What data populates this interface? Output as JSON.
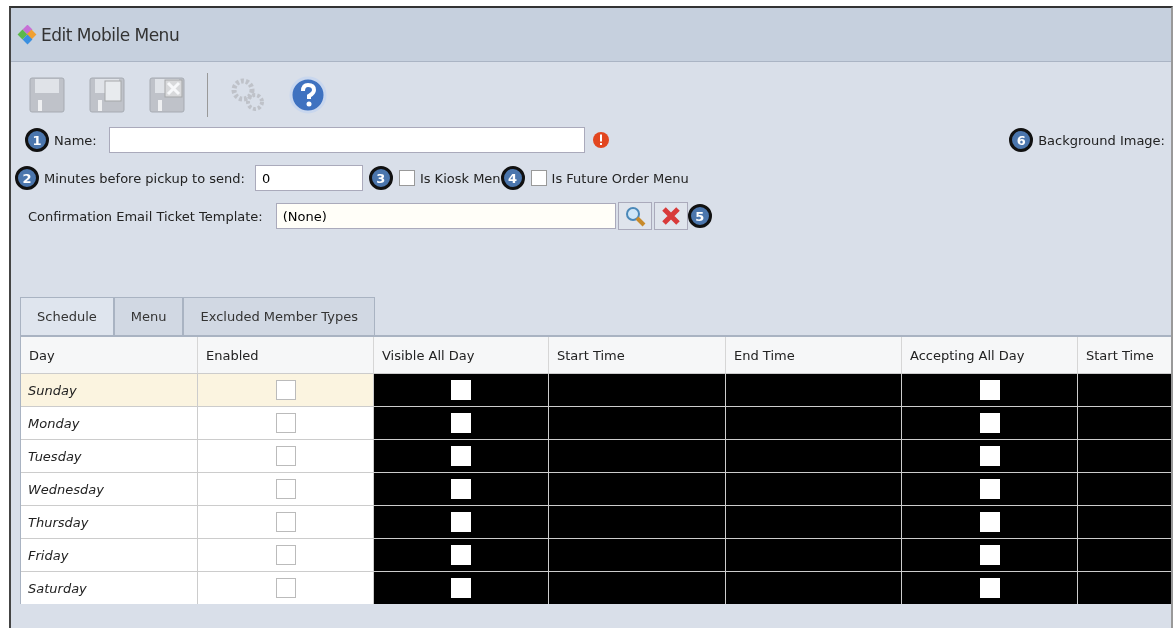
{
  "window": {
    "title": "Edit Mobile Menu"
  },
  "toolbar": [
    {
      "kind": "save",
      "disabled": true
    },
    {
      "kind": "save-new",
      "disabled": true
    },
    {
      "kind": "save-delete",
      "disabled": true
    },
    {
      "kind": "separator"
    },
    {
      "kind": "settings",
      "disabled": true
    },
    {
      "kind": "help",
      "disabled": false
    }
  ],
  "form": {
    "name": {
      "callout": "1",
      "label": "Name:",
      "error": true
    },
    "minutes": {
      "callout": "2",
      "label": "Minutes before pickup to send:",
      "value": "0"
    },
    "kiosk": {
      "callout": "3",
      "label": "Is Kiosk Men",
      "checked": false
    },
    "future": {
      "callout": "4",
      "label": "Is Future Order Menu",
      "checked": false
    },
    "template": {
      "label": "Confirmation Email Ticket Template:",
      "value": "(None)",
      "callout": "5"
    },
    "background": {
      "callout": "6",
      "label": "Background Image:"
    }
  },
  "tabs": [
    {
      "label": "Schedule",
      "selected": true
    },
    {
      "label": "Menu",
      "selected": false
    },
    {
      "label": "Excluded Member Types",
      "selected": false
    }
  ],
  "table": {
    "columns": [
      "Day",
      "Enabled",
      "Visible All Day",
      "Start Time",
      "End Time",
      "Accepting All Day",
      "Start Time"
    ],
    "rows": [
      {
        "day": "Sunday",
        "selected": true,
        "enabled": false,
        "visible_all_day": false,
        "accepting_all_day": false
      },
      {
        "day": "Monday",
        "selected": false,
        "enabled": false,
        "visible_all_day": false,
        "accepting_all_day": false
      },
      {
        "day": "Tuesday",
        "selected": false,
        "enabled": false,
        "visible_all_day": false,
        "accepting_all_day": false
      },
      {
        "day": "Wednesday",
        "selected": false,
        "enabled": false,
        "visible_all_day": false,
        "accepting_all_day": false
      },
      {
        "day": "Thursday",
        "selected": false,
        "enabled": false,
        "visible_all_day": false,
        "accepting_all_day": false
      },
      {
        "day": "Friday",
        "selected": false,
        "enabled": false,
        "visible_all_day": false,
        "accepting_all_day": false
      },
      {
        "day": "Saturday",
        "selected": false,
        "enabled": false,
        "visible_all_day": false,
        "accepting_all_day": false
      }
    ]
  }
}
